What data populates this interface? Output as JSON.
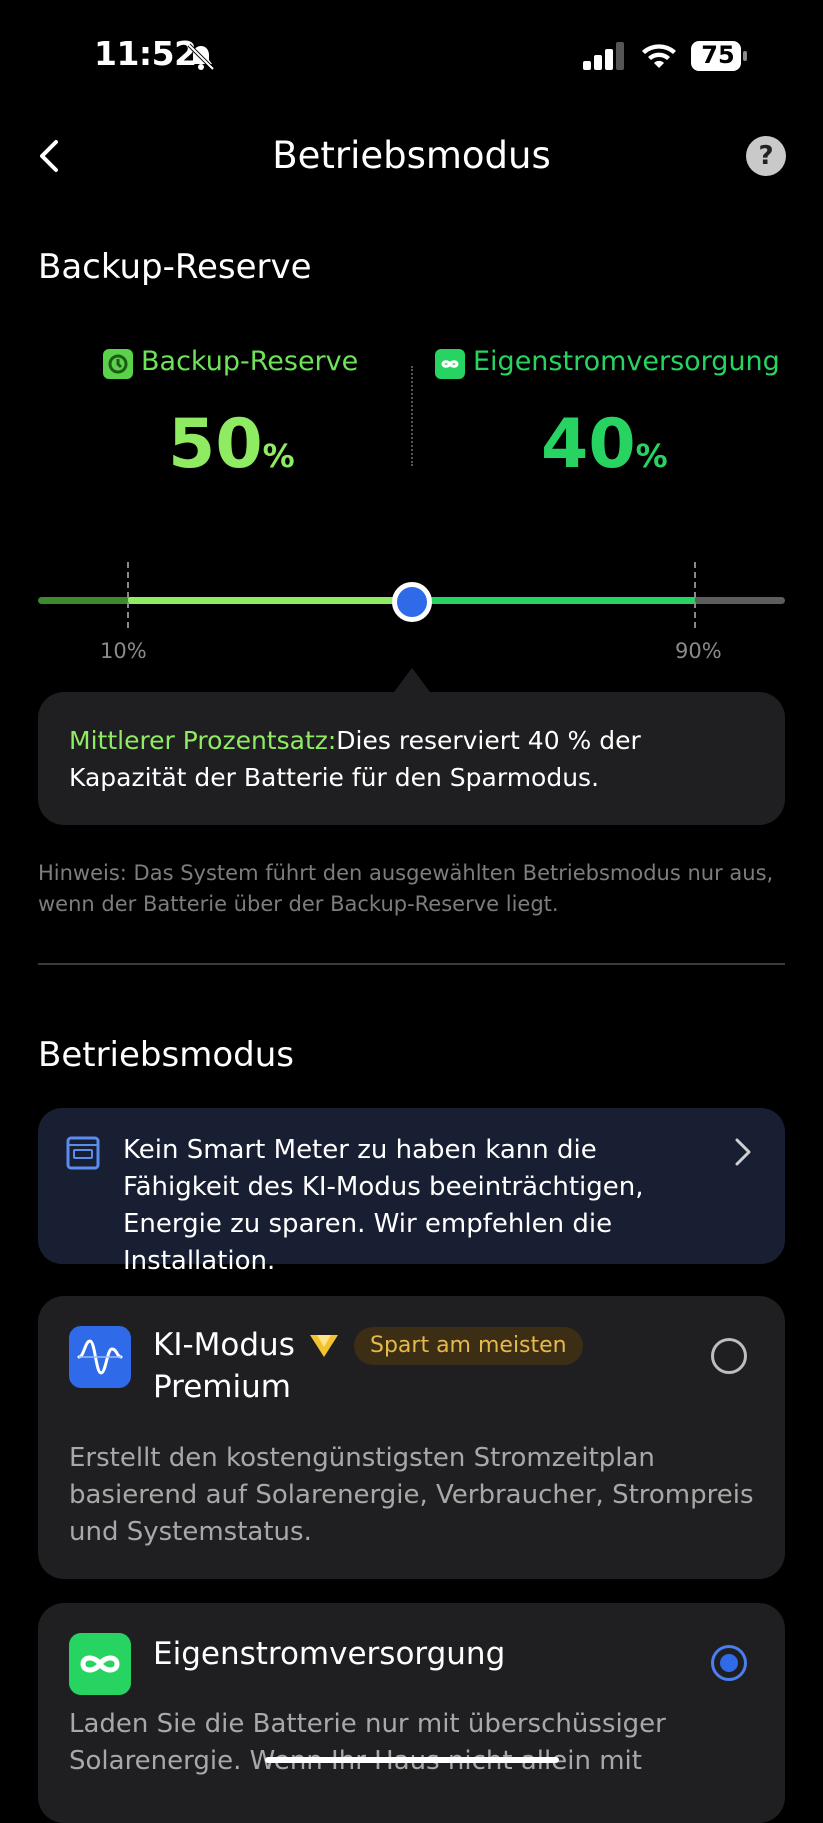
{
  "status_bar": {
    "time": "11:52",
    "battery": "75"
  },
  "header": {
    "title": "Betriebsmodus",
    "help": "?"
  },
  "reserve": {
    "section_title": "Backup-Reserve",
    "left_label": "Backup-Reserve",
    "left_value": "50",
    "right_label": "Eigenstromversorgung",
    "right_value": "40",
    "unit": "%",
    "slider_value": 50,
    "min_label": "10%",
    "max_label": "90%"
  },
  "info": {
    "highlight": "Mittlerer Prozentsatz:",
    "text": "Dies reserviert 40 % der Kapazität der Batterie für den Sparmodus."
  },
  "hint": "Hinweis: Das System führt den ausgewählten Betriebsmodus nur aus, wenn der Batterie über der Backup-Reserve liegt.",
  "modes": {
    "section_title": "Betriebsmodus",
    "banner": "Kein Smart Meter zu haben kann die Fähigkeit des KI-Modus beeinträchtigen, Energie zu sparen. Wir empfehlen die Installation.",
    "items": [
      {
        "name_line1": "KI-Modus",
        "name_line2": "Premium",
        "badge": "Spart am meisten",
        "description": "Erstellt den kostengünstigsten Stromzeitplan basierend auf Solarenergie, Verbraucher, Strompreis und Systemstatus.",
        "selected": false
      },
      {
        "name_line1": "Eigenstromversorgung",
        "description": "Laden Sie die Batterie nur mit überschüssiger Solarenergie. Wenn Ihr Haus nicht allein mit",
        "selected": true
      }
    ]
  },
  "colors": {
    "accent_green": "#6ee35a",
    "blue": "#2f6ae8",
    "badge_gold": "#e7b94a"
  }
}
